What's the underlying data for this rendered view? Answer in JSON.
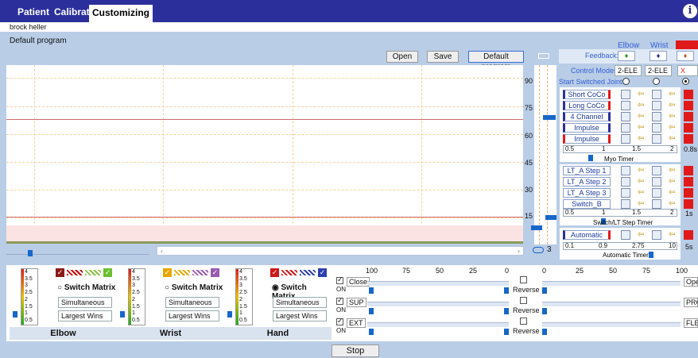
{
  "tabs": [
    {
      "label": "Patient"
    },
    {
      "label": "Calibrate"
    },
    {
      "label": "Customizing"
    }
  ],
  "user_name": "brock heller",
  "program_title": "Default program",
  "toolbar": {
    "open": "Open",
    "save": "Save",
    "default_program": "Default program"
  },
  "joints": {
    "elbow": "Elbow",
    "wrist": "Wrist",
    "hand": "Hand"
  },
  "feedback_label": "Feedback:",
  "control_modes_label": "Control Modes",
  "control_modes": [
    "2-ELE",
    "2-ELE",
    "X"
  ],
  "start_switched_joint_label": "Start Switched Joint:",
  "y_labels": [
    "90",
    "75",
    "60",
    "45",
    "30",
    "15"
  ],
  "cocontraction": [
    "Short CoCo",
    "Long CoCo",
    "4 Channel",
    "Impulse",
    "Impulse"
  ],
  "myo_timer": {
    "ticks": [
      "0.5",
      "1",
      "1.5",
      "2"
    ],
    "value": "0.8s",
    "label": "Myo Timer"
  },
  "lt_steps": [
    "LT_A Step 1",
    "LT_A Step 2",
    "LT_A Step 3",
    "Switch_B"
  ],
  "switch_timer": {
    "ticks": [
      "0.5",
      "1",
      "1.5",
      "2"
    ],
    "value": "1s",
    "label": "Switch/LT Step Timer"
  },
  "automatic": "Automatic",
  "auto_timer": {
    "ticks": [
      "0.1",
      "0.9",
      "2.75",
      "10"
    ],
    "value": "5s",
    "label": "Automatic Timer"
  },
  "scroll_value": "3",
  "bottom_panels": [
    {
      "name": "Elbow",
      "levels": [
        "4",
        "3.5",
        "3",
        "2.5",
        "2",
        "1.5",
        "1",
        "0.5"
      ],
      "switch_matrix": "Switch Matrix",
      "mode": "Simultaneous",
      "strategy": "Largest Wins"
    },
    {
      "name": "Wrist",
      "levels": [
        "4",
        "3.5",
        "3",
        "2.5",
        "2",
        "1.5",
        "1",
        "0.5"
      ],
      "switch_matrix": "Switch Matrix",
      "mode": "Simultaneous",
      "strategy": "Largest Wins"
    },
    {
      "name": "Hand",
      "levels": [
        "4",
        "3.5",
        "3",
        "2.5",
        "2",
        "1.5",
        "1",
        "0.5"
      ],
      "switch_matrix": "Switch Matrix",
      "mode": "Simultaneous",
      "strategy": "Largest Wins"
    }
  ],
  "speed_ticks_left": [
    "100",
    "75",
    "50",
    "25",
    "0"
  ],
  "speed_ticks_right": [
    "0",
    "25",
    "50",
    "75",
    "100"
  ],
  "motions": [
    {
      "left": "Close",
      "on": "ON",
      "reverse": "Reverse",
      "right": "Ope"
    },
    {
      "left": "SUP",
      "on": "ON",
      "reverse": "Reverse",
      "right": "PRO"
    },
    {
      "left": "EXT",
      "on": "ON",
      "reverse": "Reverse",
      "right": "FLE"
    }
  ],
  "stop": "Stop",
  "hand_header": "Hand"
}
